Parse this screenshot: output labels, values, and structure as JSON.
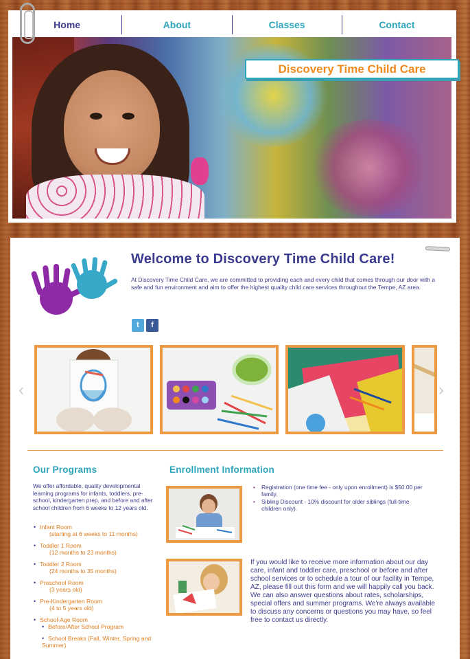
{
  "nav": {
    "items": [
      {
        "label": "Home"
      },
      {
        "label": "About"
      },
      {
        "label": "Classes"
      },
      {
        "label": "Contact"
      }
    ]
  },
  "hero": {
    "site_title": "Discovery Time Child Care"
  },
  "welcome": {
    "heading": "Welcome to Discovery Time Child Care!",
    "intro": "At Discovery Time Child Care, we are committed to providing each and every child that comes through our door with a safe and fun environment and aim to offer the highest quality child care services throughout the Tempe, AZ area."
  },
  "social": {
    "twitter_glyph": "t",
    "facebook_glyph": "f"
  },
  "programs": {
    "heading": "Our Programs",
    "intro": "We offer affordable, quality developmental learning programs for infants, toddlers, pre-school, kindergarten prep, and before and after school children from 6 weeks to 12 years old.",
    "items": [
      {
        "title": "Infant Room",
        "detail": "(starting at 6 weeks to 11 months)"
      },
      {
        "title": "Toddler 1 Room",
        "detail": "(12 months to 23 months)"
      },
      {
        "title": "Toddler 2 Room",
        "detail": "(24 months to 35 months)"
      },
      {
        "title": "Preschool Room",
        "detail": "(3 years old)"
      },
      {
        "title": "Pre-Kindergarten Room",
        "detail": "(4 to 5 years old)"
      },
      {
        "title": "School-Age Room",
        "detail": "Before/After School Program",
        "detail2": "School Breaks (Fall, Winter, Spring and Summer)"
      }
    ]
  },
  "enrollment": {
    "heading": "Enrollment Information",
    "fees": [
      "Registration (one time fee - only upon enrollment) is $50.00 per family.",
      "Sibling Discount -  10% discount for older siblings (full-time children only)."
    ],
    "contact_text": "If you would like to receive more information about our day care, infant and toddler care, preschool or before and after school services or to schedule a tour of our facility in Tempe, AZ, please fill out this form and we will happily call you back. We can also answer questions about rates, scholarships, special offers and summer programs. We're always available to discuss any concerns or questions you may have, so feel free to contact us directly."
  },
  "carousel": {
    "left_arrow": "‹",
    "right_arrow": "›",
    "images": [
      {
        "icon": "child-drawing-image"
      },
      {
        "icon": "paint-palette-image"
      },
      {
        "icon": "craft-paper-image"
      },
      {
        "icon": "crayons-image"
      }
    ]
  },
  "colors": {
    "navy": "#3b3b8e",
    "teal": "#2da6bb",
    "orange": "#ec9a44",
    "accent_orange_text": "#e07b1c"
  }
}
